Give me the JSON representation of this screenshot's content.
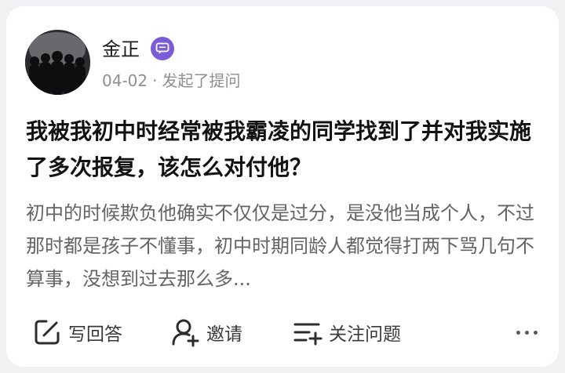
{
  "author": {
    "name": "金正",
    "badge_icon": "chat-badge-icon",
    "badge_color": "#7b5cd6"
  },
  "meta": {
    "date": "04-02",
    "separator": "·",
    "action_text": "发起了提问"
  },
  "question": {
    "title": "我被我初中时经常被我霸凌的同学找到了并对我实施了多次报复，该怎么对付他？",
    "excerpt": "初中的时候欺负他确实不仅仅是过分，是没他当成个人，不过那时都是孩子不懂事，初中时期同龄人都觉得打两下骂几句不算事，没想到过去那么多..."
  },
  "actions": {
    "write_answer": "写回答",
    "invite": "邀请",
    "follow_question": "关注问题",
    "more_icon": "more-icon"
  }
}
